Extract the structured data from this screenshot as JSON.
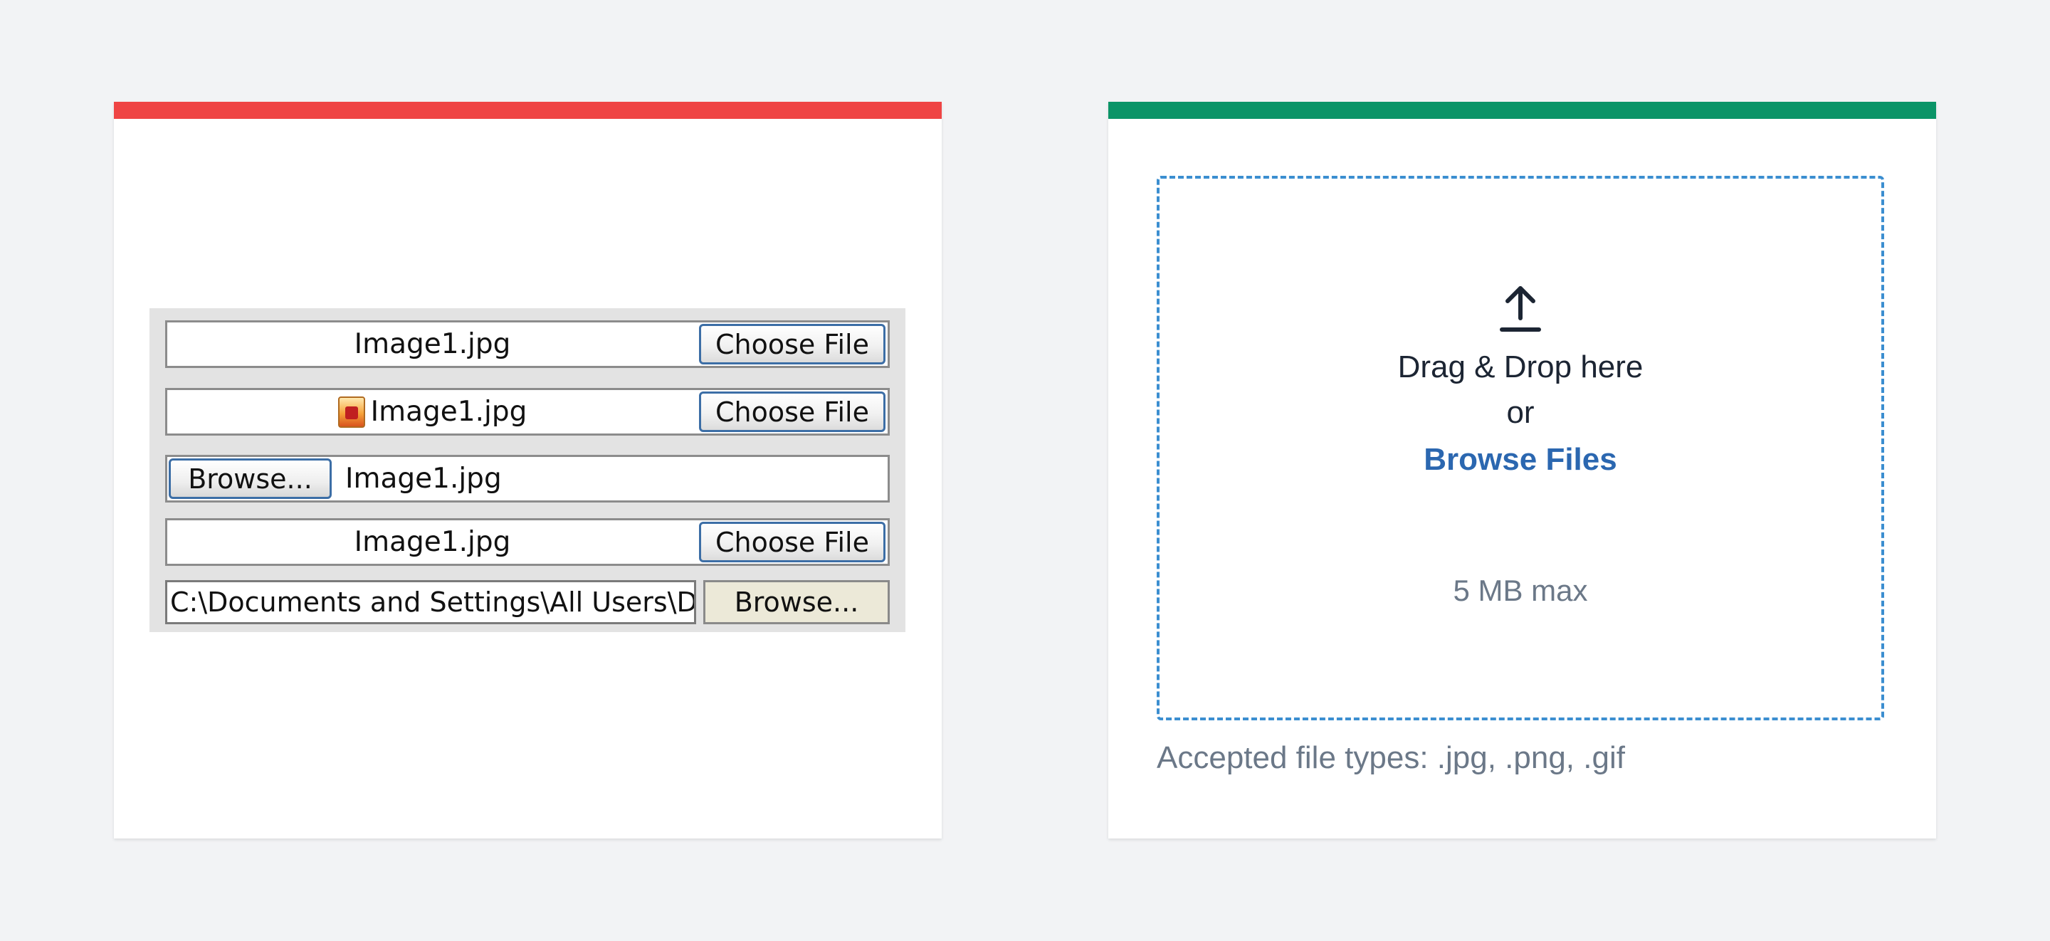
{
  "colors": {
    "background": "#f2f3f5",
    "card": "#ffffff",
    "bad_accent": "#ef4444",
    "good_accent": "#0b9467",
    "dropzone_border": "#3b8ed0",
    "link": "#2b67b0",
    "muted_text": "#6b7888"
  },
  "legacy_examples": {
    "rows": [
      {
        "file_name": "Image1.jpg",
        "button_label": "Choose File"
      },
      {
        "file_name": "Image1.jpg",
        "button_label": "Choose File",
        "icon": "image-file-icon"
      },
      {
        "file_name": "Image1.jpg",
        "button_label": "Browse..."
      },
      {
        "file_name": "Image1.jpg",
        "button_label": "Choose File"
      },
      {
        "path_value": "C:\\Documents and Settings\\All Users\\Documents",
        "button_label": "Browse..."
      }
    ]
  },
  "upload": {
    "icon": "upload-arrow-icon",
    "drag_text": "Drag & Drop here",
    "or_text": "or",
    "browse_label": "Browse Files",
    "max_size": "5 MB max",
    "accepted_types": "Accepted file types: .jpg, .png, .gif"
  }
}
